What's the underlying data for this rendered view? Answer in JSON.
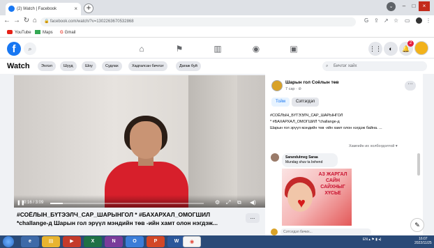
{
  "browser": {
    "tab_title": "(2) Watch | Facebook",
    "tab_close": "×",
    "new_tab": "+",
    "url": "facebook.com/watch/?v=1302263670532868",
    "bookmarks": [
      "YouTube",
      "Maps",
      "Gmail"
    ]
  },
  "facebook": {
    "logo": "f",
    "notification_count": "2"
  },
  "watch": {
    "title": "Watch",
    "pills": [
      "Эхлэл",
      "Шууд",
      "Шоу",
      "Судлах",
      "Хадгалсан бичлэг",
      "Дагаж буй"
    ],
    "search_placeholder": "Бичлэг хайх"
  },
  "video": {
    "time": "0:16 / 3:09",
    "progress_fraction": 0.08,
    "title_line1": "#СОЁЛЫН_БҮТЭЭЛЧ_САР_ШАРЫНГОЛ * #БАХАРХАЛ_ОМОГШИЛ",
    "title_line2": "*challange-д Шарын гол эрүүл мэндийн төв -ийн хамт олон нэгдэж...",
    "more": "..."
  },
  "sidebar": {
    "page_name": "Шарын гол Соёлын төв",
    "date": "7 сар · ⊘",
    "follow_label": "Тойм",
    "comments_label": "Сэтгэгдэл",
    "desc_line1": "#СОЁЛЫН_БҮТЭЭЛЧ_САР_ШАРЫНГОЛ",
    "desc_line2": "* #БАХАРХАЛ_ОМОГШИЛ *challange-д",
    "desc_line3": "Шарын гол эрүүл мэндийн төв -ийн хамт олон нэгдэж байна. ...",
    "sort_label": "Хамгийн их холбогдолтой ▾",
    "comment_author": "Sarandulmeg Saraa",
    "comment_text": "Mundag shuv ta bvhend",
    "image_text_line1": "АЗ ЖАРГАЛ",
    "image_text_line2": "САЙН",
    "image_text_line3": "САЙХНЫГ",
    "image_text_line4": "ХҮСЬЕ",
    "input_placeholder": "Сэтгэгдэл бичих..."
  },
  "taskbar": {
    "clock_time": "16:07",
    "clock_date": "2022/11/25"
  }
}
